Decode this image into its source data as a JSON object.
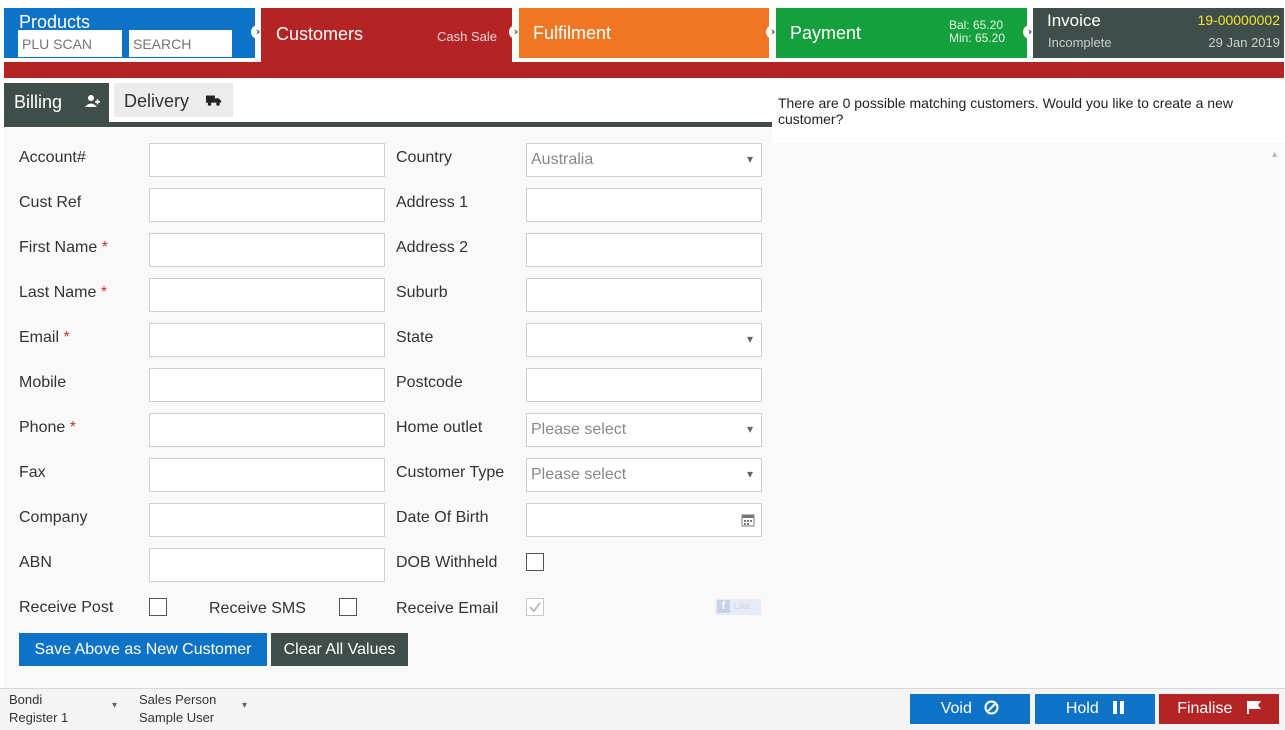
{
  "steps": {
    "products": {
      "title": "Products",
      "plu_placeholder": "PLU SCAN",
      "search_placeholder": "SEARCH"
    },
    "customers": {
      "title": "Customers",
      "sub": "Cash Sale"
    },
    "fulfilment": {
      "title": "Fulfilment"
    },
    "payment": {
      "title": "Payment",
      "bal": "Bal: 65.20",
      "min": "Min: 65.20"
    },
    "invoice": {
      "title": "Invoice",
      "status": "Incomplete",
      "number": "19-00000002",
      "date": "29 Jan 2019"
    }
  },
  "tabs": {
    "billing": "Billing",
    "delivery": "Delivery"
  },
  "match_message": "There are 0 possible matching customers. Would you like to create a new customer?",
  "form": {
    "left": [
      {
        "label": "Account#",
        "required": ""
      },
      {
        "label": "Cust Ref",
        "required": ""
      },
      {
        "label": "First Name",
        "required": "*"
      },
      {
        "label": "Last Name",
        "required": "*"
      },
      {
        "label": "Email",
        "required": "*"
      },
      {
        "label": "Mobile",
        "required": ""
      },
      {
        "label": "Phone",
        "required": "*"
      },
      {
        "label": "Fax",
        "required": ""
      },
      {
        "label": "Company",
        "required": ""
      },
      {
        "label": "ABN",
        "required": ""
      }
    ],
    "right": {
      "country_label": "Country",
      "country_value": "Australia",
      "address1_label": "Address 1",
      "address2_label": "Address 2",
      "suburb_label": "Suburb",
      "state_label": "State",
      "postcode_label": "Postcode",
      "home_outlet_label": "Home outlet",
      "home_outlet_value": "Please select",
      "customer_type_label": "Customer Type",
      "customer_type_value": "Please select",
      "dob_label": "Date Of Birth",
      "dob_withheld_label": "DOB Withheld"
    },
    "receive_post": "Receive Post",
    "receive_sms": "Receive SMS",
    "receive_email": "Receive Email",
    "fb_like": "Like",
    "save_button": "Save Above as New Customer",
    "clear_button": "Clear All Values"
  },
  "footer": {
    "outlet": "Bondi",
    "register": "Register 1",
    "sales_person_label": "Sales Person",
    "sales_person": "Sample User",
    "void": "Void",
    "hold": "Hold",
    "finalise": "Finalise"
  },
  "colors": {
    "products": "#0e72c7",
    "customers": "#b52424",
    "fulfilment": "#ef7623",
    "payment": "#14a03c",
    "invoice": "#3f4e4b"
  }
}
